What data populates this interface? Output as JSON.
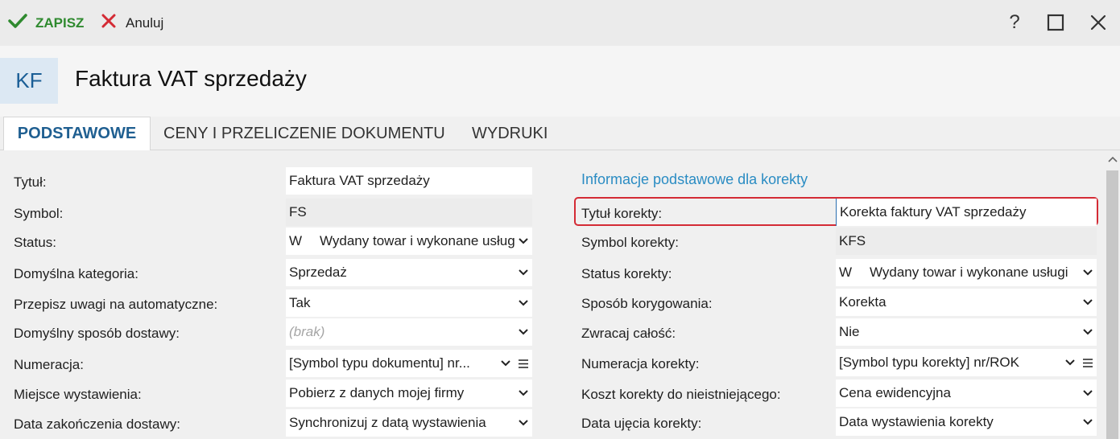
{
  "toolbar": {
    "save_label": "ZAPISZ",
    "cancel_label": "Anuluj",
    "help_label": "?"
  },
  "header": {
    "badge": "KF",
    "title": "Faktura VAT sprzedaży"
  },
  "tabs": [
    {
      "label": "PODSTAWOWE",
      "active": true
    },
    {
      "label": "CENY I PRZELICZENIE DOKUMENTU",
      "active": false
    },
    {
      "label": "WYDRUKI",
      "active": false
    }
  ],
  "left": {
    "rows": [
      {
        "label": "Tytuł:",
        "value": "Faktura VAT sprzedaży"
      },
      {
        "label": "Symbol:",
        "value": "FS"
      },
      {
        "label": "Status:",
        "code": "W",
        "value": "Wydany towar i wykonane usługi"
      },
      {
        "label": "Domyślna kategoria:",
        "value": "Sprzedaż"
      },
      {
        "label": "Przepisz uwagi na automatyczne:",
        "value": "Tak"
      },
      {
        "label": "Domyślny sposób dostawy:",
        "placeholder": "(brak)"
      },
      {
        "label": "Numeracja:",
        "value": "[Symbol typu dokumentu] nr..."
      },
      {
        "label": "Miejsce wystawienia:",
        "value": "Pobierz z danych mojej firmy"
      },
      {
        "label": "Data zakończenia dostawy:",
        "value": "Synchronizuj z datą wystawienia"
      }
    ]
  },
  "right": {
    "section_title": "Informacje podstawowe dla korekty",
    "rows": [
      {
        "label": "Tytuł korekty:",
        "value": "Korekta faktury VAT sprzedaży"
      },
      {
        "label": "Symbol korekty:",
        "value": "KFS"
      },
      {
        "label": "Status korekty:",
        "code": "W",
        "value": "Wydany towar i wykonane usługi"
      },
      {
        "label": "Sposób korygowania:",
        "value": "Korekta"
      },
      {
        "label": "Zwracaj całość:",
        "value": "Nie"
      },
      {
        "label": "Numeracja korekty:",
        "value": "[Symbol typu korekty] nr/ROK"
      },
      {
        "label": "Koszt korekty do nieistniejącego:",
        "value": "Cena ewidencyjna"
      },
      {
        "label": "Data ujęcia korekty:",
        "value": "Data wystawienia korekty"
      }
    ]
  },
  "colors": {
    "accent": "#1f5f91",
    "save": "#2f8a2f",
    "cancel": "#d42b35",
    "section": "#2a8cc3",
    "highlight": "#d42b35"
  }
}
